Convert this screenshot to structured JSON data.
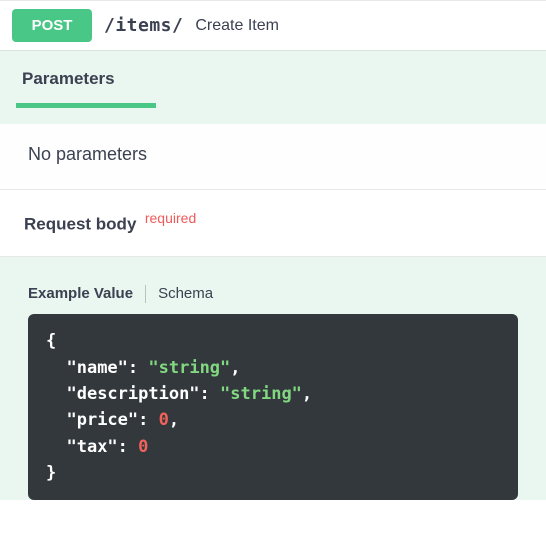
{
  "operation": {
    "method": "POST",
    "path": "/items/",
    "summary": "Create Item"
  },
  "sections": {
    "parameters_title": "Parameters",
    "no_parameters": "No parameters",
    "request_body_title": "Request body",
    "required_label": "required"
  },
  "tabs": {
    "example_value": "Example Value",
    "schema": "Schema"
  },
  "example_json": {
    "fields": [
      {
        "key": "name",
        "type": "string",
        "value_display": "\"string\""
      },
      {
        "key": "description",
        "type": "string",
        "value_display": "\"string\""
      },
      {
        "key": "price",
        "type": "number",
        "value_display": "0"
      },
      {
        "key": "tax",
        "type": "number",
        "value_display": "0"
      }
    ]
  },
  "colors": {
    "method_post": "#49c786",
    "required": "#f15a5a",
    "code_bg": "#33383d",
    "code_string": "#82d880",
    "code_number": "#f1635a"
  }
}
